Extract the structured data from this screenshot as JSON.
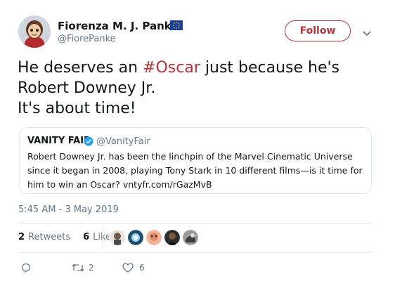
{
  "author": {
    "name": "Fiorenza M. J. Panke",
    "handle": "@FiorePanke"
  },
  "follow_label": "Follow",
  "tweet": {
    "text_before": "He deserves an ",
    "hashtag": "#Oscar",
    "text_after": " just because he's",
    "line2": "Robert Downey Jr.",
    "line3": "It's about time!"
  },
  "quote": {
    "name": "VANITY FAIR",
    "handle": "@VanityFair",
    "body": "Robert Downey Jr. has been the linchpin of the Marvel Cinematic Universe since it began in 2008, playing Tony Stark in 10 different films—is it time for him to win an Oscar? vntyfr.com/rGazMvB"
  },
  "timestamp": "5:45 AM - 3 May 2019",
  "stats": {
    "retweets_count": "2",
    "retweets_label": "Retweets",
    "likes_count": "6",
    "likes_label": "Likes"
  },
  "actions": {
    "retweet_count": "2",
    "like_count": "6"
  },
  "colors": {
    "accent": "#b4343b",
    "muted": "#657786",
    "verified": "#1da1f2"
  },
  "icons": [
    "eu-flag-icon",
    "chevron-down-icon",
    "verified-icon",
    "reply-icon",
    "retweet-icon",
    "like-icon"
  ]
}
